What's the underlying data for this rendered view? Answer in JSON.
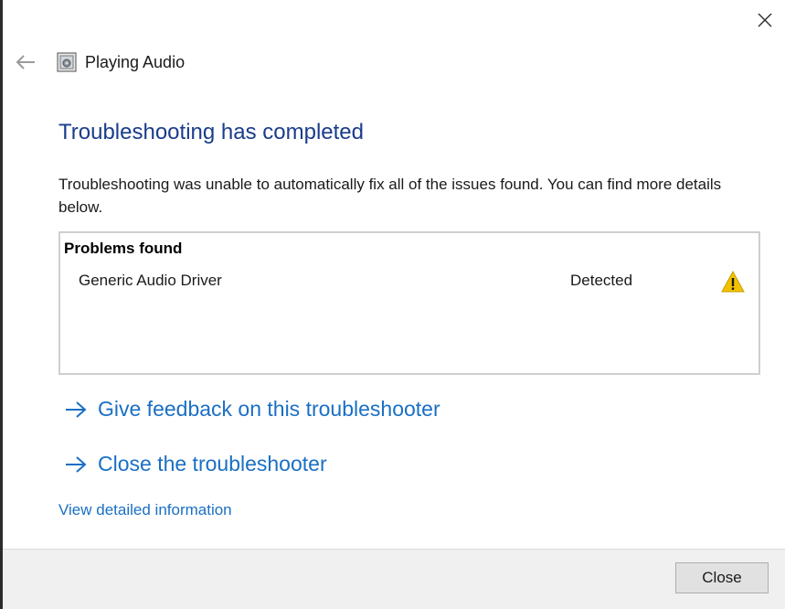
{
  "window": {
    "app_title": "Playing Audio",
    "close_icon": "close-icon",
    "back_icon": "back-arrow-icon",
    "app_icon": "speaker-icon"
  },
  "main": {
    "heading": "Troubleshooting has completed",
    "description": "Troubleshooting was unable to automatically fix all of the issues found. You can find more details below.",
    "problems": {
      "header": "Problems found",
      "items": [
        {
          "name": "Generic Audio Driver",
          "status": "Detected",
          "icon": "warning-icon",
          "icon_color": "#f2c200"
        }
      ]
    },
    "links": {
      "feedback": "Give feedback on this troubleshooter",
      "close_troubleshooter": "Close the troubleshooter",
      "details": "View detailed information"
    }
  },
  "footer": {
    "close_label": "Close"
  },
  "colors": {
    "heading": "#1a3c8c",
    "link": "#1a6fc4",
    "footer_bg": "#f0f0f0"
  }
}
